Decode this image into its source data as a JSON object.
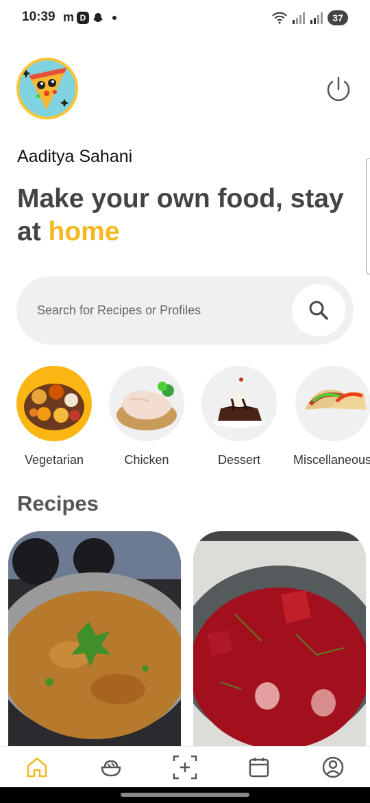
{
  "status_bar": {
    "time": "10:39",
    "left_icons": [
      "m",
      "D"
    ],
    "battery": "37"
  },
  "header": {
    "avatar_icon": "pizza-avatar-icon",
    "power_icon": "power-icon",
    "username": "Aaditya Sahani",
    "headline_main": "Make your own food, stay at",
    "headline_accent": "home",
    "accent_color": "#f5b91f"
  },
  "search": {
    "placeholder": "Search for Recipes or Profiles",
    "icon": "search-icon"
  },
  "categories": [
    {
      "label": "Vegetarian",
      "active": true
    },
    {
      "label": "Chicken",
      "active": false
    },
    {
      "label": "Dessert",
      "active": false
    },
    {
      "label": "Miscellaneous",
      "active": false
    }
  ],
  "recipes_section": {
    "title": "Recipes"
  },
  "bottom_nav": [
    {
      "icon": "home-icon",
      "active": true
    },
    {
      "icon": "bowl-icon",
      "active": false
    },
    {
      "icon": "add-icon",
      "active": false
    },
    {
      "icon": "calendar-icon",
      "active": false
    },
    {
      "icon": "profile-icon",
      "active": false
    }
  ]
}
